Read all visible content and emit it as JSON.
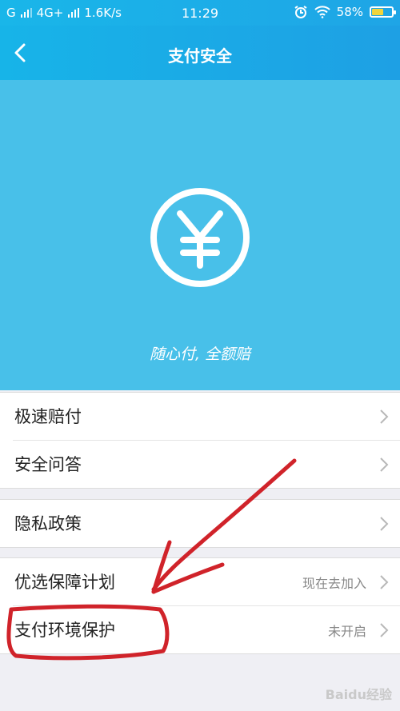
{
  "status_bar": {
    "carrier_left": "G",
    "network": "4G+",
    "speed": "1.6K/s",
    "time": "11:29",
    "battery_percent": "58%",
    "battery_level": 0.58
  },
  "nav": {
    "title": "支付安全"
  },
  "hero": {
    "slogan": "随心付, 全额赔",
    "icon": "yen-circle-icon"
  },
  "menu_groups": [
    {
      "items": [
        {
          "label": "极速赔付",
          "value": ""
        },
        {
          "label": "安全问答",
          "value": ""
        }
      ]
    },
    {
      "items": [
        {
          "label": "隐私政策",
          "value": ""
        }
      ]
    },
    {
      "items": [
        {
          "label": "优选保障计划",
          "value": "现在去加入"
        },
        {
          "label": "支付环境保护",
          "value": "未开启"
        }
      ]
    }
  ],
  "watermark": "Baidu经验",
  "colors": {
    "nav_bg": "#1fa8e6",
    "hero_bg": "#48c0e9",
    "annotation": "#d0232a",
    "battery_fill": "#f2d43c"
  }
}
